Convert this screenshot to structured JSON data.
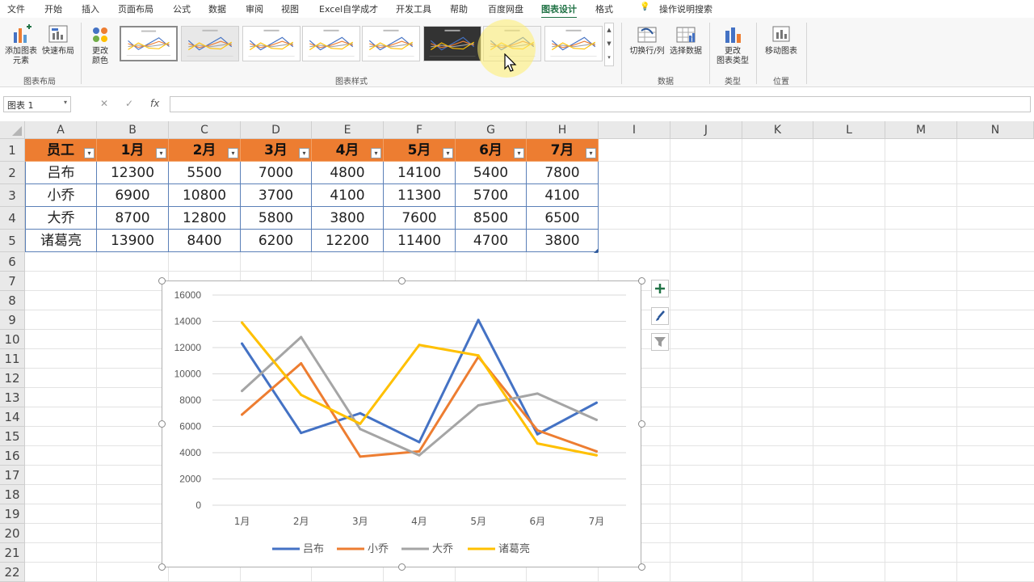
{
  "menu": {
    "tabs": [
      {
        "label": "文件",
        "active": false
      },
      {
        "label": "开始",
        "active": false
      },
      {
        "label": "插入",
        "active": false
      },
      {
        "label": "页面布局",
        "active": false
      },
      {
        "label": "公式",
        "active": false
      },
      {
        "label": "数据",
        "active": false
      },
      {
        "label": "审阅",
        "active": false
      },
      {
        "label": "视图",
        "active": false
      },
      {
        "label": "Excel自学成才",
        "active": false
      },
      {
        "label": "开发工具",
        "active": false
      },
      {
        "label": "帮助",
        "active": false
      },
      {
        "label": "百度网盘",
        "active": false
      },
      {
        "label": "图表设计",
        "active": true
      },
      {
        "label": "格式",
        "active": false
      }
    ],
    "tell_me": "操作说明搜索"
  },
  "ribbon": {
    "add_chart_element": "添加图表\n元素",
    "quick_layout": "快速布局",
    "group_layout": "图表布局",
    "change_colors": "更改\n颜色",
    "group_styles": "图表样式",
    "switch_row_col": "切换行/列",
    "select_data": "选择数据",
    "group_data": "数据",
    "change_type": "更改\n图表类型",
    "group_type": "类型",
    "move_chart": "移动图表",
    "group_location": "位置"
  },
  "formula_bar": {
    "name_box": "图表 1",
    "fx_label": "fx",
    "cancel_glyph": "✕",
    "enter_glyph": "✓",
    "dropdown_glyph": "▾"
  },
  "sheet": {
    "columns": [
      "A",
      "B",
      "C",
      "D",
      "E",
      "F",
      "G",
      "H",
      "I",
      "J",
      "K",
      "L",
      "M",
      "N"
    ],
    "rows": [
      "1",
      "2",
      "3",
      "4",
      "5",
      "6",
      "7",
      "8",
      "9",
      "10",
      "11",
      "12",
      "13",
      "14",
      "15",
      "16",
      "17",
      "18",
      "19",
      "20",
      "21",
      "22"
    ],
    "table_header": [
      "员工",
      "1月",
      "2月",
      "3月",
      "4月",
      "5月",
      "6月",
      "7月"
    ],
    "table_rows": [
      [
        "吕布",
        "12300",
        "5500",
        "7000",
        "4800",
        "14100",
        "5400",
        "7800"
      ],
      [
        "小乔",
        "6900",
        "10800",
        "3700",
        "4100",
        "11300",
        "5700",
        "4100"
      ],
      [
        "大乔",
        "8700",
        "12800",
        "5800",
        "3800",
        "7600",
        "8500",
        "6500"
      ],
      [
        "诸葛亮",
        "13900",
        "8400",
        "6200",
        "12200",
        "11400",
        "4700",
        "3800"
      ]
    ],
    "filter_glyph": "▾"
  },
  "chart_data": {
    "type": "line",
    "categories": [
      "1月",
      "2月",
      "3月",
      "4月",
      "5月",
      "6月",
      "7月"
    ],
    "series": [
      {
        "name": "吕布",
        "values": [
          12300,
          5500,
          7000,
          4800,
          14100,
          5400,
          7800
        ],
        "color": "#4472c4"
      },
      {
        "name": "小乔",
        "values": [
          6900,
          10800,
          3700,
          4100,
          11300,
          5700,
          4100
        ],
        "color": "#ed7d31"
      },
      {
        "name": "大乔",
        "values": [
          8700,
          12800,
          5800,
          3800,
          7600,
          8500,
          6500
        ],
        "color": "#a5a5a5"
      },
      {
        "name": "诸葛亮",
        "values": [
          13900,
          8400,
          6200,
          12200,
          11400,
          4700,
          3800
        ],
        "color": "#ffc000"
      }
    ],
    "yticks": [
      "0",
      "2000",
      "4000",
      "6000",
      "8000",
      "10000",
      "12000",
      "14000",
      "16000"
    ],
    "ylim": [
      0,
      16000
    ],
    "grid": true,
    "legend": "bottom"
  },
  "chart_side_buttons": [
    "chart-elements-plus",
    "chart-styles-brush",
    "chart-filter"
  ],
  "colors": {
    "accent": "#217346",
    "header_fill": "#ed7d31",
    "table_border": "#5b80b8"
  }
}
